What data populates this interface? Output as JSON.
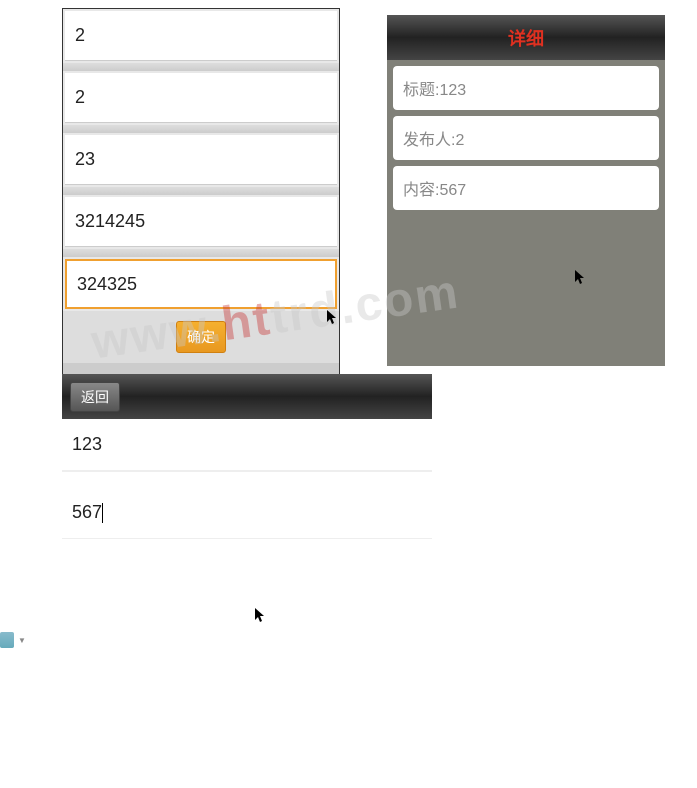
{
  "panel1": {
    "fields": [
      "2",
      "2",
      "23",
      "3214245",
      "324325"
    ],
    "confirm_label": "确定"
  },
  "panel2": {
    "title": "详细",
    "rows": [
      {
        "text": "标题:123"
      },
      {
        "text": "发布人:2"
      },
      {
        "text": "内容:567"
      }
    ]
  },
  "panel3": {
    "back_label": "返回",
    "row1": "123",
    "row2": "567"
  },
  "watermark": {
    "prefix": "www.",
    "mid": "ht",
    "suffix": "trd.com"
  }
}
